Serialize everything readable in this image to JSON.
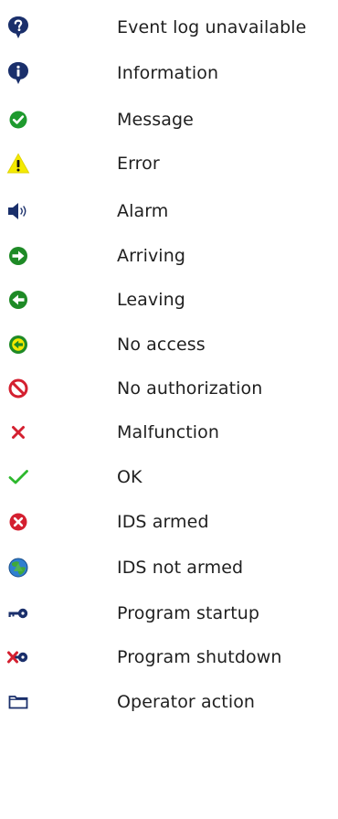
{
  "legend": {
    "items": [
      {
        "icon": "speech-bubble-question-icon",
        "label": "Event log unavailable"
      },
      {
        "icon": "speech-bubble-info-icon",
        "label": "Information"
      },
      {
        "icon": "green-check-circle-icon",
        "label": "Message"
      },
      {
        "icon": "yellow-warning-triangle-icon",
        "label": "Error"
      },
      {
        "icon": "speaker-icon",
        "label": "Alarm"
      },
      {
        "icon": "green-arrow-right-icon",
        "label": "Arriving"
      },
      {
        "icon": "green-arrow-left-icon",
        "label": "Leaving"
      },
      {
        "icon": "yellow-arrow-left-no-access-icon",
        "label": "No access"
      },
      {
        "icon": "prohibited-icon",
        "label": "No authorization"
      },
      {
        "icon": "red-x-icon",
        "label": "Malfunction"
      },
      {
        "icon": "green-check-icon",
        "label": "OK"
      },
      {
        "icon": "red-x-circle-icon",
        "label": "IDS armed"
      },
      {
        "icon": "globe-icon",
        "label": "IDS not armed"
      },
      {
        "icon": "key-icon",
        "label": "Program startup"
      },
      {
        "icon": "key-crossed-icon",
        "label": "Program shutdown"
      },
      {
        "icon": "folder-icon",
        "label": "Operator action"
      }
    ]
  },
  "colors": {
    "navy": "#1a2f6b",
    "green": "#1e9a2e",
    "red": "#d42030",
    "yellow": "#f4ea00",
    "text": "#1f1f1f"
  }
}
